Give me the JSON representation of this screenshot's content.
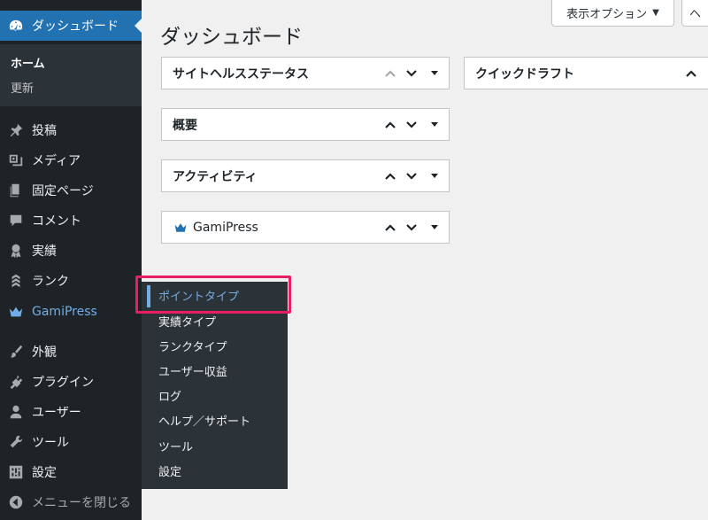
{
  "sidebar": {
    "dashboard_label": "ダッシュボード",
    "submenu": {
      "home": "ホーム",
      "updates": "更新"
    },
    "items": {
      "posts": "投稿",
      "media": "メディア",
      "pages": "固定ページ",
      "comments": "コメント",
      "achievements": "実績",
      "ranks": "ランク",
      "gamipress": "GamiPress",
      "appearance": "外観",
      "plugins": "プラグイン",
      "users": "ユーザー",
      "tools": "ツール",
      "settings": "設定",
      "collapse": "メニューを閉じる"
    }
  },
  "flyout": {
    "items": [
      "ポイントタイプ",
      "実績タイプ",
      "ランクタイプ",
      "ユーザー収益",
      "ログ",
      "ヘルプ／サポート",
      "ツール",
      "設定"
    ]
  },
  "header": {
    "page_title": "ダッシュボード",
    "screen_options": "表示オプション",
    "help_partial": "ヘ"
  },
  "widgets": {
    "site_health": "サイトヘルスステータス",
    "overview": "概要",
    "activity": "アクティビティ",
    "gamipress": "GamiPress",
    "quick_draft": "クイックドラフト"
  },
  "colors": {
    "accent": "#2271b1",
    "sidebar_bg": "#1d2327",
    "flyout_bg": "#2c3338",
    "highlight": "#e91e63",
    "gami": "#72aee6"
  }
}
